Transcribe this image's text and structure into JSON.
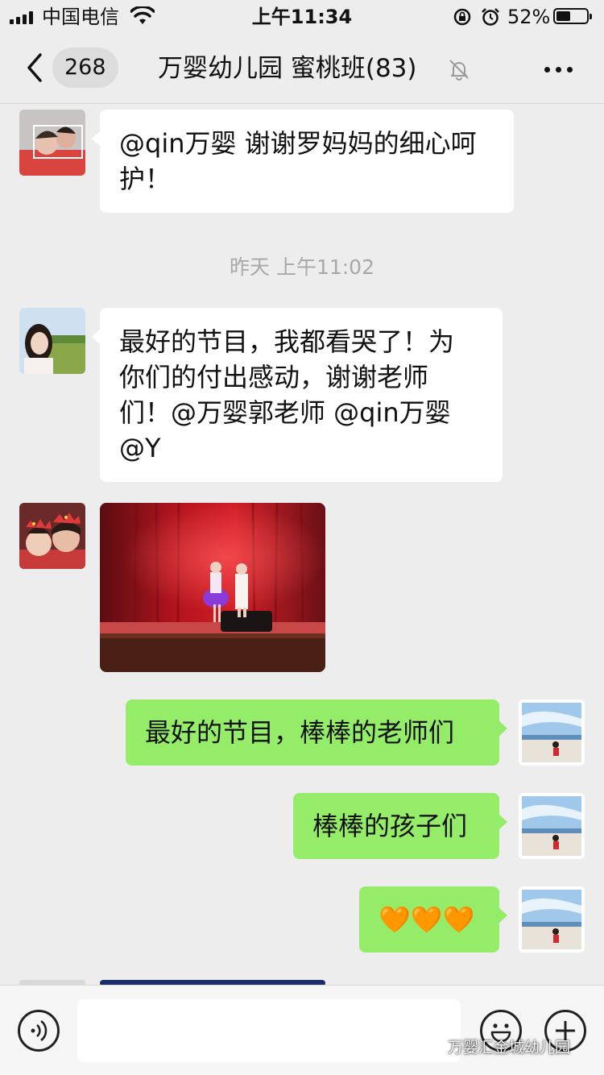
{
  "status_bar": {
    "carrier": "中国电信",
    "time": "上午11:34",
    "battery_percent": "52%",
    "battery_level": 0.52
  },
  "header": {
    "unread_count": "268",
    "title": "万婴幼儿园 蜜桃班(83)",
    "muted_icon": "bell-slash-icon",
    "more_icon": "ellipsis-icon",
    "back_icon": "chevron-left-icon"
  },
  "messages": [
    {
      "type": "text",
      "direction": "incoming",
      "text_lines": [
        "@qin万婴 谢谢罗妈妈的细心呵",
        "护！"
      ]
    },
    {
      "type": "timestamp",
      "text": "昨天 上午11:02"
    },
    {
      "type": "text",
      "direction": "incoming",
      "text_lines": [
        "最好的节目，我都看哭了！为",
        "你们的付出感动，谢谢老师",
        "们！@万婴郭老师 @qin万婴",
        "@Y"
      ]
    },
    {
      "type": "image",
      "direction": "incoming",
      "description": "stage-photo"
    },
    {
      "type": "text",
      "direction": "outgoing",
      "text": "最好的节目，棒棒的老师们"
    },
    {
      "type": "text",
      "direction": "outgoing",
      "text": "棒棒的孩子们"
    },
    {
      "type": "text",
      "direction": "outgoing",
      "text": "🧡🧡🧡"
    }
  ],
  "input_bar": {
    "voice_icon": "voice-icon",
    "message_value": "",
    "emoji_icon": "smiley-icon",
    "plus_icon": "plus-icon"
  },
  "watermark": "万婴汇金城幼儿园",
  "colors": {
    "background": "#ededed",
    "outgoing_bubble": "#95ec69",
    "incoming_bubble": "#ffffff",
    "timestamp_text": "#a8a8a8"
  }
}
